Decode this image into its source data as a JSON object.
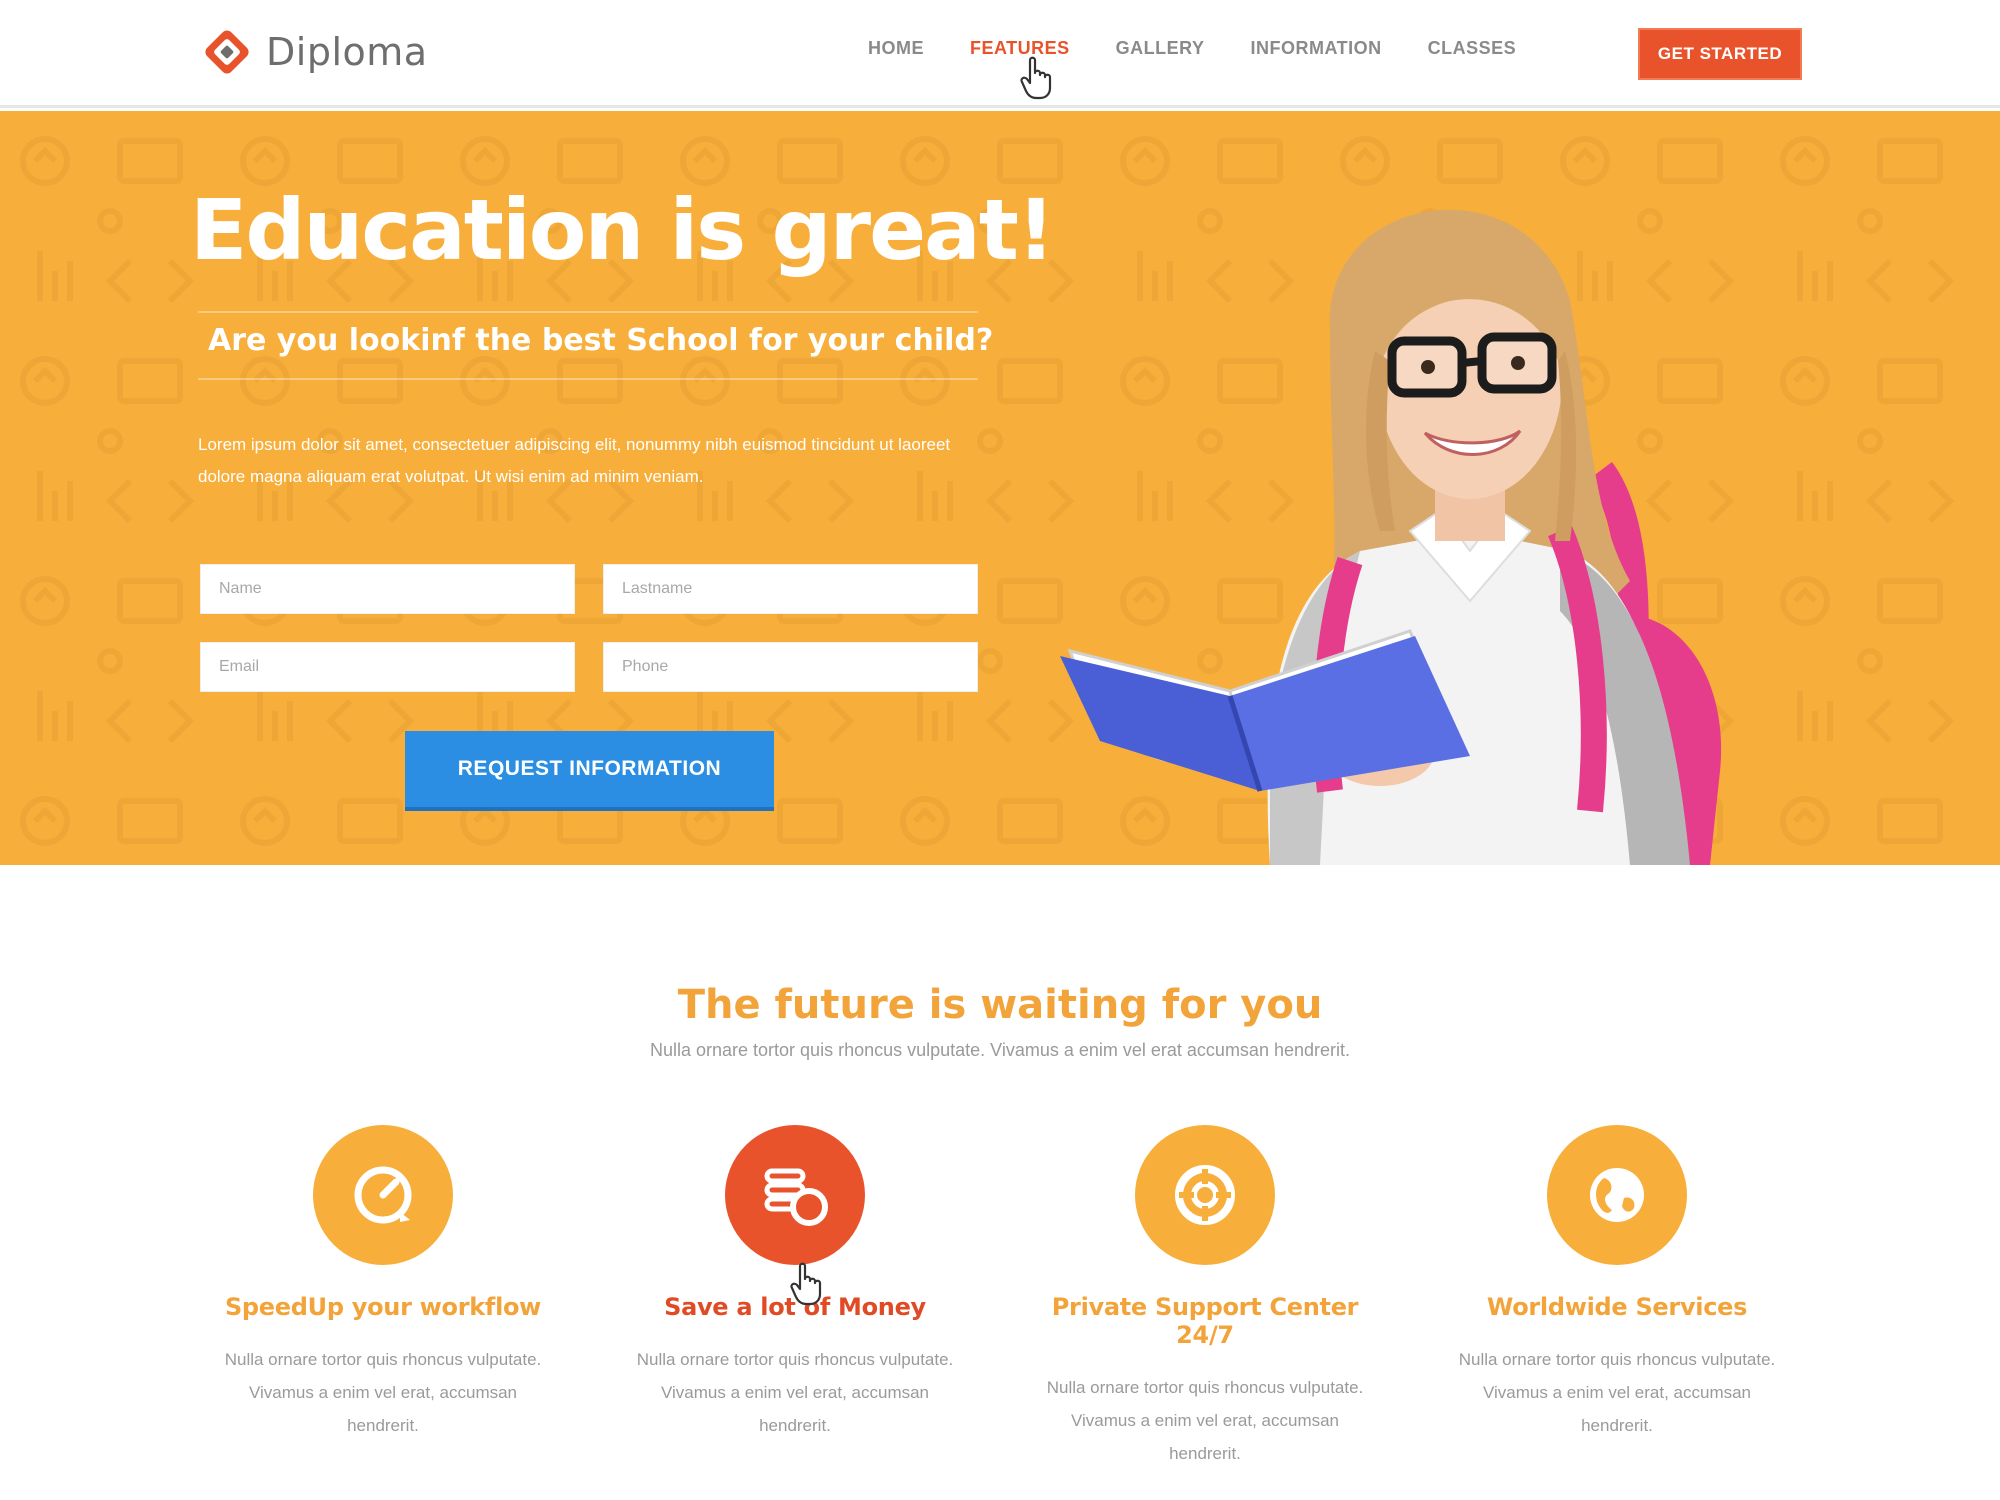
{
  "brand": {
    "name": "Diploma"
  },
  "nav": {
    "items": [
      {
        "label": "HOME",
        "active": false
      },
      {
        "label": "FEATURES",
        "active": true
      },
      {
        "label": "GALLERY",
        "active": false
      },
      {
        "label": "INFORMATION",
        "active": false
      },
      {
        "label": "CLASSES",
        "active": false
      }
    ],
    "cta_label": "GET STARTED"
  },
  "hero": {
    "title": "Education is great!",
    "subtitle": "Are you lookinf the best School for your child?",
    "body": "Lorem ipsum dolor sit amet, consectetuer adipiscing elit, nonummy nibh euismod tincidunt ut laoreet dolore magna aliquam erat volutpat. Ut wisi enim ad minim veniam.",
    "form": {
      "name_placeholder": "Name",
      "lastname_placeholder": "Lastname",
      "email_placeholder": "Email",
      "phone_placeholder": "Phone",
      "submit_label": "REQUEST INFORMATION"
    }
  },
  "features": {
    "title": "The future is waiting for you",
    "subtitle": "Nulla ornare tortor quis rhoncus vulputate. Vivamus a enim vel erat accumsan hendrerit.",
    "items": [
      {
        "title": "SpeedUp your workflow",
        "body": "Nulla ornare tortor quis rhoncus vulputate. Vivamus a enim vel erat, accumsan hendrerit.",
        "icon": "speedometer-icon"
      },
      {
        "title": "Save a lot of Money",
        "body": "Nulla ornare tortor quis rhoncus vulputate. Vivamus a enim vel erat, accumsan hendrerit.",
        "icon": "coins-icon"
      },
      {
        "title": "Private Support Center 24/7",
        "body": "Nulla ornare tortor quis rhoncus vulputate. Vivamus a enim vel erat, accumsan hendrerit.",
        "icon": "lifebuoy-icon"
      },
      {
        "title": "Worldwide Services",
        "body": "Nulla ornare tortor quis rhoncus vulputate. Vivamus a enim vel erat, accumsan hendrerit.",
        "icon": "globe-icon"
      }
    ]
  },
  "colors": {
    "accent_orange": "#f7ae3a",
    "accent_red": "#e9532c",
    "button_blue": "#2b8ee3"
  }
}
